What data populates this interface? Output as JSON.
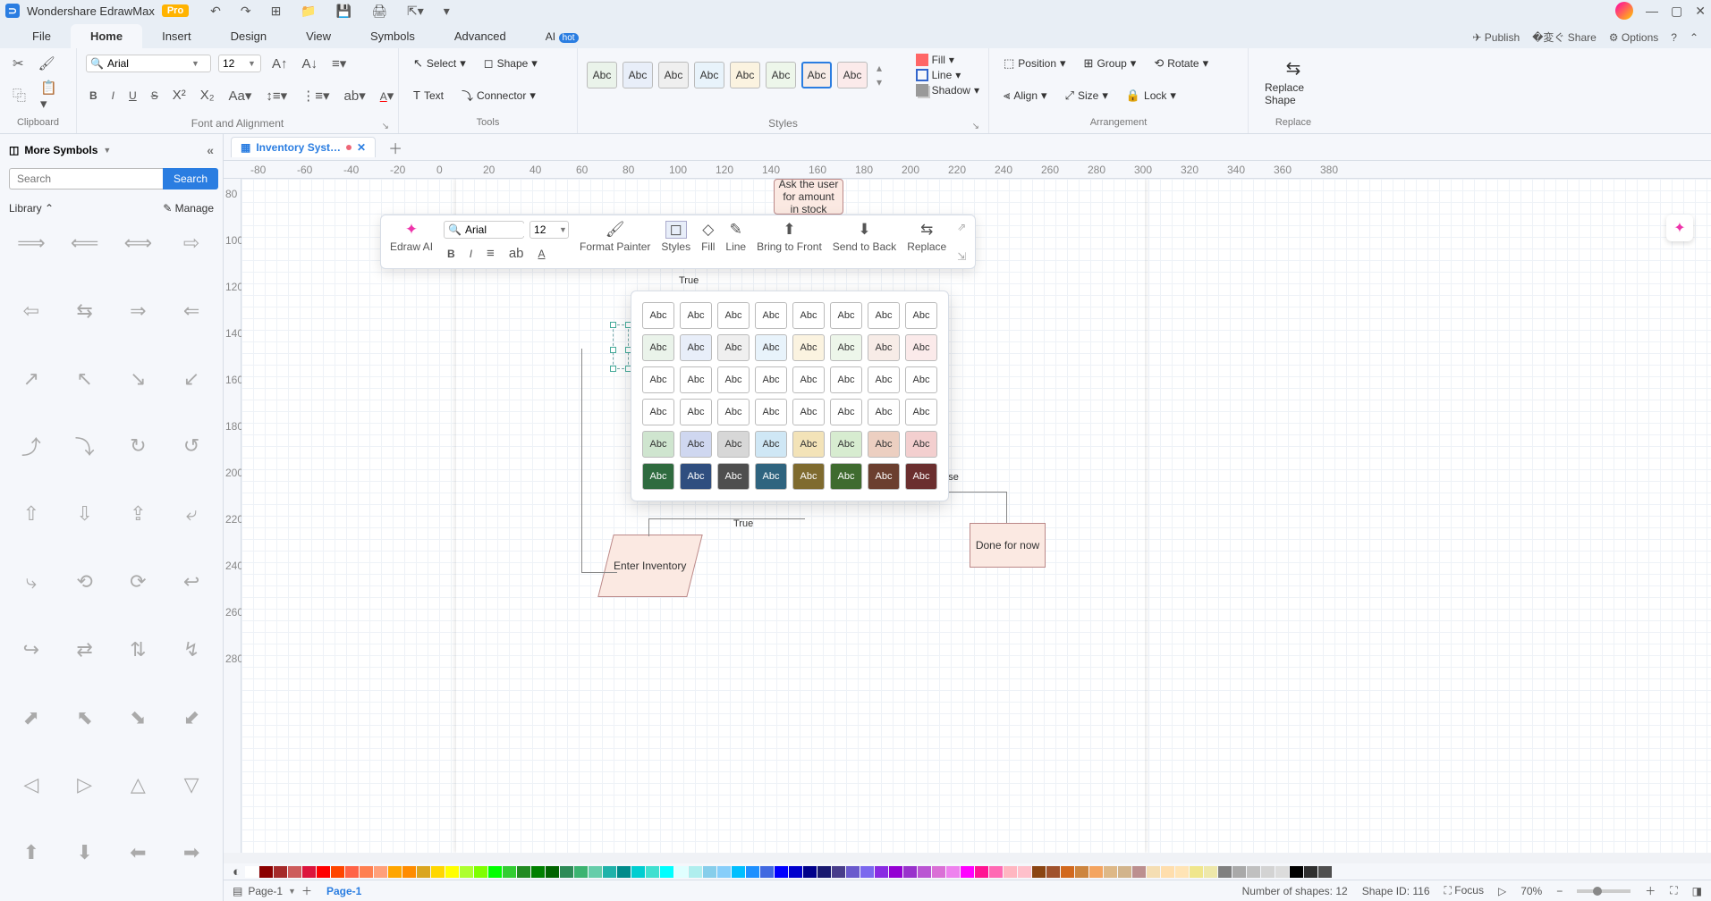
{
  "app": {
    "name": "Wondershare EdrawMax",
    "badge": "Pro"
  },
  "menu": {
    "tabs": [
      "File",
      "Home",
      "Insert",
      "Design",
      "View",
      "Symbols",
      "Advanced",
      "AI"
    ],
    "active": "Home",
    "hot": "hot",
    "right": {
      "publish": "Publish",
      "share": "Share",
      "options": "Options"
    }
  },
  "ribbon": {
    "clipboard": {
      "label": "Clipboard"
    },
    "font": {
      "label": "Font and Alignment",
      "family": "Arial",
      "size": "12"
    },
    "tools": {
      "label": "Tools",
      "select": "Select",
      "shape": "Shape",
      "text": "Text",
      "connector": "Connector"
    },
    "styles": {
      "label": "Styles",
      "sample": "Abc",
      "fill": "Fill",
      "line": "Line",
      "shadow": "Shadow"
    },
    "arrange": {
      "label": "Arrangement",
      "position": "Position",
      "align": "Align",
      "group": "Group",
      "size": "Size",
      "rotate": "Rotate",
      "lock": "Lock"
    },
    "replace": {
      "label": "Replace",
      "btn": "Replace Shape"
    }
  },
  "left": {
    "title": "More Symbols",
    "search_ph": "Search",
    "search_btn": "Search",
    "library": "Library",
    "manage": "Manage"
  },
  "doc": {
    "tab": "Inventory Syst…"
  },
  "ruler_h": [
    -80,
    -60,
    -40,
    -20,
    0,
    20,
    40,
    60,
    80,
    100,
    120,
    140,
    160,
    180,
    200,
    220,
    240,
    260,
    280,
    300,
    320,
    340,
    360,
    380
  ],
  "ruler_v": [
    80,
    100,
    120,
    140,
    160,
    180,
    200,
    220,
    240,
    260,
    280
  ],
  "mini": {
    "ai": "Edraw AI",
    "family": "Arial",
    "size": "12",
    "painter": "Format Painter",
    "styles": "Styles",
    "fill": "Fill",
    "line": "Line",
    "front": "Bring to Front",
    "back": "Send to Back",
    "replace": "Replace"
  },
  "popup": {
    "sample": "Abc",
    "colors": [
      [
        "#ffffff",
        "#ffffff",
        "#ffffff",
        "#ffffff",
        "#ffffff",
        "#ffffff",
        "#ffffff",
        "#ffffff"
      ],
      [
        "#eaf3ea",
        "#e8eef9",
        "#efefef",
        "#e8f3fb",
        "#fbf3e0",
        "#edf6ea",
        "#f7ece7",
        "#fbeaea"
      ],
      [
        "#ffffff",
        "#ffffff",
        "#ffffff",
        "#ffffff",
        "#ffffff",
        "#ffffff",
        "#ffffff",
        "#ffffff"
      ],
      [
        "#ffffff",
        "#ffffff",
        "#ffffff",
        "#ffffff",
        "#ffffff",
        "#ffffff",
        "#ffffff",
        "#ffffff"
      ],
      [
        "#cfe5cf",
        "#cfd7f0",
        "#d7d7d7",
        "#cfe7f5",
        "#f3e3b8",
        "#d7ecd0",
        "#eccfc1",
        "#f3cfcf"
      ],
      [
        "#2f6b3f",
        "#2f4e7f",
        "#4e4e4e",
        "#2f647f",
        "#7f6b2f",
        "#3f6b2f",
        "#6b3f2f",
        "#6b2f2f"
      ]
    ],
    "text": [
      [
        "#333",
        "#333",
        "#333",
        "#333",
        "#333",
        "#333",
        "#333",
        "#333"
      ],
      [
        "#333",
        "#333",
        "#333",
        "#333",
        "#333",
        "#333",
        "#333",
        "#333"
      ],
      [
        "#333",
        "#333",
        "#333",
        "#333",
        "#333",
        "#333",
        "#333",
        "#333"
      ],
      [
        "#333",
        "#333",
        "#333",
        "#333",
        "#333",
        "#333",
        "#333",
        "#333"
      ],
      [
        "#333",
        "#333",
        "#333",
        "#333",
        "#333",
        "#333",
        "#333",
        "#333"
      ],
      [
        "#fff",
        "#fff",
        "#fff",
        "#fff",
        "#fff",
        "#fff",
        "#fff",
        "#fff"
      ]
    ]
  },
  "shapes": {
    "top": "Ask the user for amount in stock",
    "true1": "True",
    "true2": "True",
    "false": "False",
    "enter": "Enter Inventory",
    "done": "Done for now"
  },
  "colorbar": [
    "#ffffff",
    "#8b0000",
    "#a52a2a",
    "#cd5c5c",
    "#dc143c",
    "#ff0000",
    "#ff4500",
    "#ff6347",
    "#ff7f50",
    "#ffa07a",
    "#ffa500",
    "#ff8c00",
    "#daa520",
    "#ffd700",
    "#ffff00",
    "#adff2f",
    "#7fff00",
    "#00ff00",
    "#32cd32",
    "#228b22",
    "#008000",
    "#006400",
    "#2e8b57",
    "#3cb371",
    "#66cdaa",
    "#20b2aa",
    "#008b8b",
    "#00ced1",
    "#40e0d0",
    "#00ffff",
    "#e0ffff",
    "#afeeee",
    "#87ceeb",
    "#87cefa",
    "#00bfff",
    "#1e90ff",
    "#4169e1",
    "#0000ff",
    "#0000cd",
    "#00008b",
    "#191970",
    "#483d8b",
    "#6a5acd",
    "#7b68ee",
    "#8a2be2",
    "#9400d3",
    "#9932cc",
    "#ba55d3",
    "#da70d6",
    "#ee82ee",
    "#ff00ff",
    "#ff1493",
    "#ff69b4",
    "#ffb6c1",
    "#ffc0cb",
    "#8b4513",
    "#a0522d",
    "#d2691e",
    "#cd853f",
    "#f4a460",
    "#deb887",
    "#d2b48c",
    "#bc8f8f",
    "#f5deb3",
    "#ffdead",
    "#ffe4b5",
    "#f0e68c",
    "#eee8aa",
    "#808080",
    "#a9a9a9",
    "#c0c0c0",
    "#d3d3d3",
    "#dcdcdc",
    "#000000",
    "#2f2f2f",
    "#4f4f4f"
  ],
  "status": {
    "page": "Page-1",
    "active": "Page-1",
    "shapes": "Number of shapes: 12",
    "shapeid": "Shape ID: 116",
    "focus": "Focus",
    "zoom": "70%"
  }
}
